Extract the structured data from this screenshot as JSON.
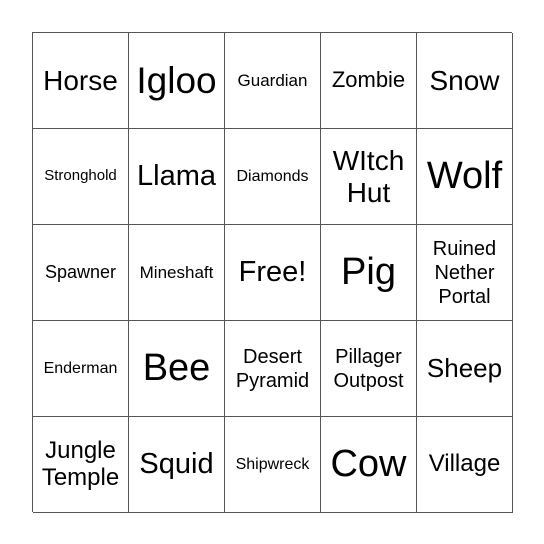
{
  "card": {
    "cells": [
      [
        "Horse",
        "Igloo",
        "Guardian",
        "Zombie",
        "Snow"
      ],
      [
        "Stronghold",
        "Llama",
        "Diamonds",
        "WItch\nHut",
        "Wolf"
      ],
      [
        "Spawner",
        "Mineshaft",
        "Free!",
        "Pig",
        "Ruined\nNether\nPortal"
      ],
      [
        "Enderman",
        "Bee",
        "Desert\nPyramid",
        "Pillager\nOutpost",
        "Sheep"
      ],
      [
        "Jungle\nTemple",
        "Squid",
        "Shipwreck",
        "Cow",
        "Village"
      ]
    ]
  }
}
